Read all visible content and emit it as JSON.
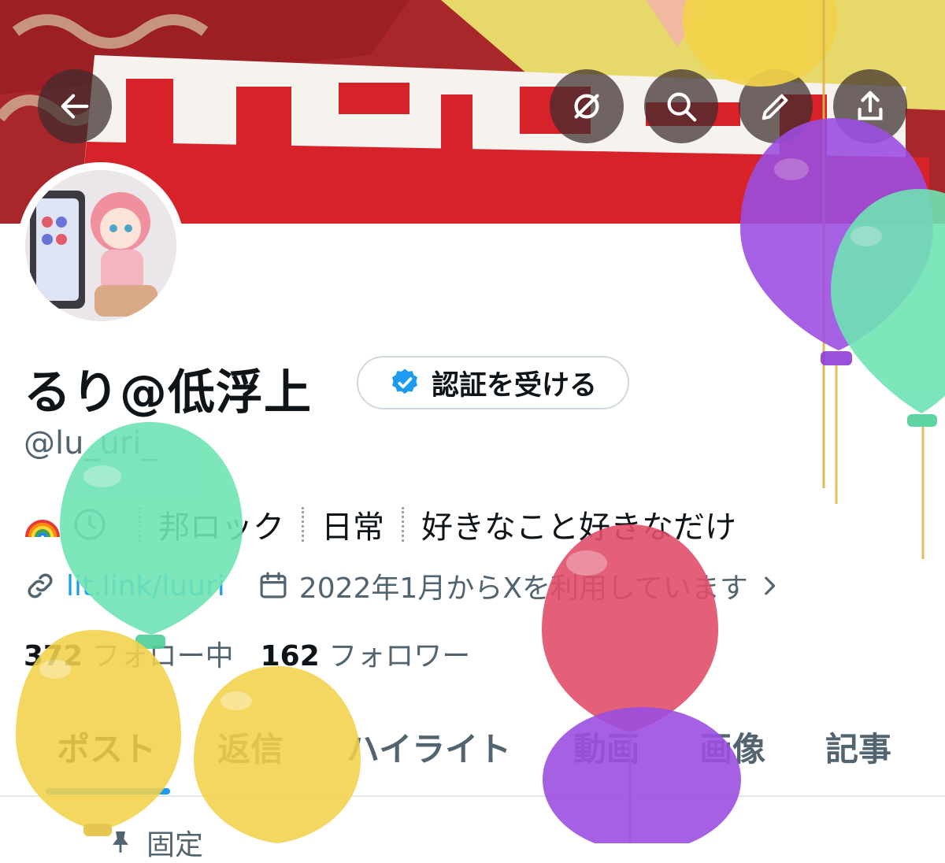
{
  "header": {
    "back_icon": "arrow-left-icon",
    "hide_icon": "slashed-circle-icon",
    "search_icon": "search-icon",
    "edit_icon": "pencil-icon",
    "share_icon": "share-icon"
  },
  "profile": {
    "display_name": "るり@低浮上",
    "verify_label": "認証を受ける",
    "handle": "@lu_uri_",
    "bio": {
      "emoji": "🌈",
      "parts": [
        "邦ロック",
        "日常",
        "好きなこと好きなだけ"
      ]
    },
    "link": "lit.link/luuri",
    "joined": "2022年1月からXを利用しています",
    "stats": {
      "following_count": "372",
      "following_label": "フォロー中",
      "followers_count": "162",
      "followers_label": "フォロワー"
    }
  },
  "tabs": [
    "ポスト",
    "返信",
    "ハイライト",
    "動画",
    "画像",
    "記事"
  ],
  "active_tab": "ポスト",
  "pinned_label": "固定",
  "colors": {
    "accent": "#1d9bf0",
    "text": "#0f1419",
    "muted": "#536471",
    "balloon_yellow": "#f2d24a",
    "balloon_mint": "#6fe3b4",
    "balloon_purple": "#9b4fe0",
    "balloon_red": "#e24e6a"
  }
}
